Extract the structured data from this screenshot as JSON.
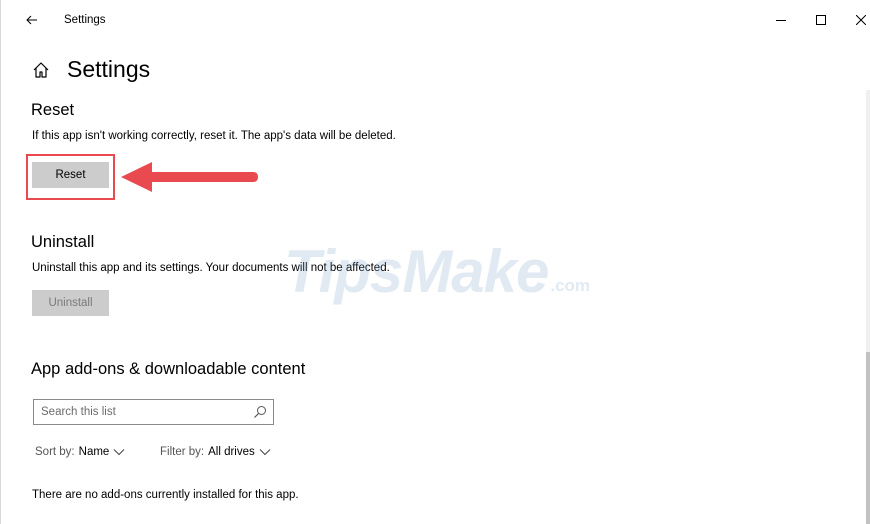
{
  "window": {
    "title": "Settings",
    "controls": {
      "minimize": "minimize",
      "maximize": "maximize",
      "close": "close"
    }
  },
  "header": {
    "title": "Settings"
  },
  "reset": {
    "title": "Reset",
    "description": "If this app isn't working correctly, reset it. The app's data will be deleted.",
    "button_label": "Reset"
  },
  "uninstall": {
    "title": "Uninstall",
    "description": "Uninstall this app and its settings. Your documents will not be affected.",
    "button_label": "Uninstall"
  },
  "addons": {
    "title": "App add-ons & downloadable content",
    "search_placeholder": "Search this list",
    "sort_label": "Sort by:",
    "sort_value": "Name",
    "filter_label": "Filter by:",
    "filter_value": "All drives",
    "empty_message": "There are no add-ons currently installed for this app."
  },
  "watermark": {
    "main": "TipsMake",
    "sub": ".com"
  },
  "colors": {
    "highlight": "#e84a4f",
    "button_bg": "#cccccc"
  },
  "icons": [
    "back-arrow-icon",
    "minimize-icon",
    "maximize-icon",
    "close-icon",
    "home-icon",
    "search-icon",
    "chevron-down-icon",
    "red-arrow-icon"
  ]
}
